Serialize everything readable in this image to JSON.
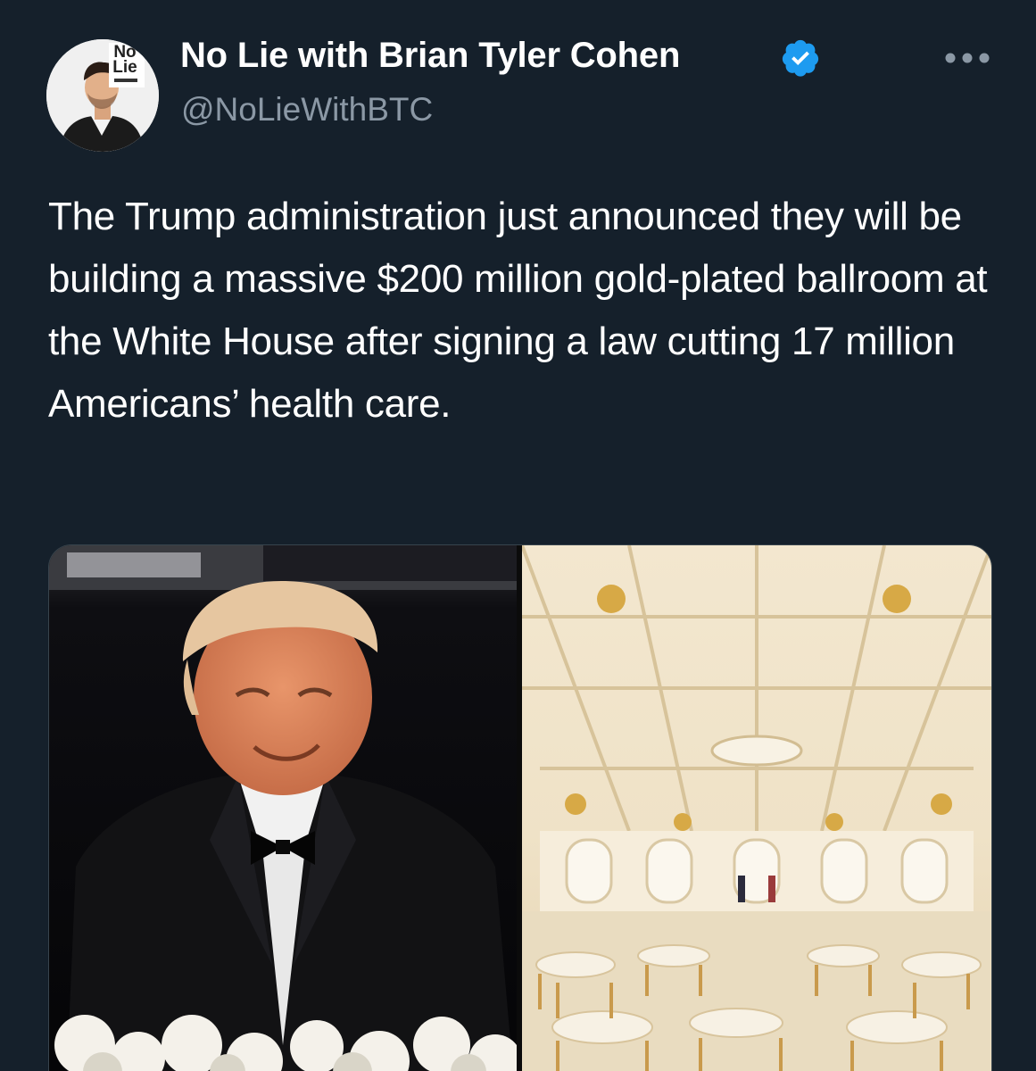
{
  "author": {
    "display_name": "No Lie with Brian Tyler Cohen",
    "handle": "@NoLieWithBTC",
    "avatar_logo_line1": "No",
    "avatar_logo_line2": "Lie",
    "verified": true
  },
  "tweet": {
    "text": "The Trump administration just announced they will be building a massive $200 million gold-plated ballroom at the White House after signing a law cutting 17 million Americans’ health care."
  },
  "icons": {
    "verified": "verified-badge-icon",
    "more": "more-options-icon"
  },
  "colors": {
    "background": "#15202b",
    "text_primary": "#ffffff",
    "text_secondary": "#8b98a5",
    "verified_blue": "#1d9bf0"
  },
  "media": {
    "left": "photo-man-in-tuxedo",
    "right": "photo-gold-ballroom-rendering"
  }
}
